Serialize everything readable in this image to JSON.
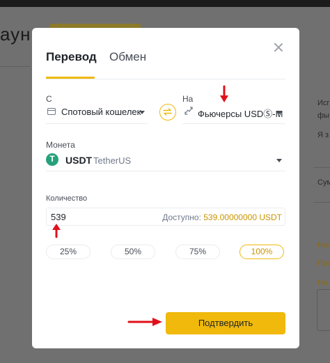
{
  "background": {
    "left_title": "аун",
    "right_texts": [
      "Исг",
      "фы",
      "Я з",
      "Сум",
      "Нач",
      "Про",
      "На"
    ]
  },
  "modal": {
    "tabs": [
      {
        "label": "Перевод",
        "active": true
      },
      {
        "label": "Обмен",
        "active": false
      }
    ],
    "from": {
      "label": "С",
      "value": "Спотовый кошелек",
      "icon": "wallet-icon"
    },
    "to": {
      "label": "На",
      "value": "Фьючерсы USDⓈ-M",
      "icon": "futures-icon"
    },
    "coin": {
      "label": "Монета",
      "symbol": "USDT",
      "name": "TetherUS",
      "icon": "tether-icon"
    },
    "amount": {
      "label": "Количество",
      "value": "539",
      "available_label": "Доступно:",
      "available_value": "539.00000000 USDT"
    },
    "percent_buttons": [
      {
        "label": "25%",
        "active": false
      },
      {
        "label": "50%",
        "active": false
      },
      {
        "label": "75%",
        "active": false
      },
      {
        "label": "100%",
        "active": true
      }
    ],
    "confirm_label": "Подтвердить"
  },
  "colors": {
    "accent": "#f0b90b",
    "accent_text": "#c99400",
    "annotation_arrow": "#e0101a",
    "tether_green": "#26a17b"
  }
}
